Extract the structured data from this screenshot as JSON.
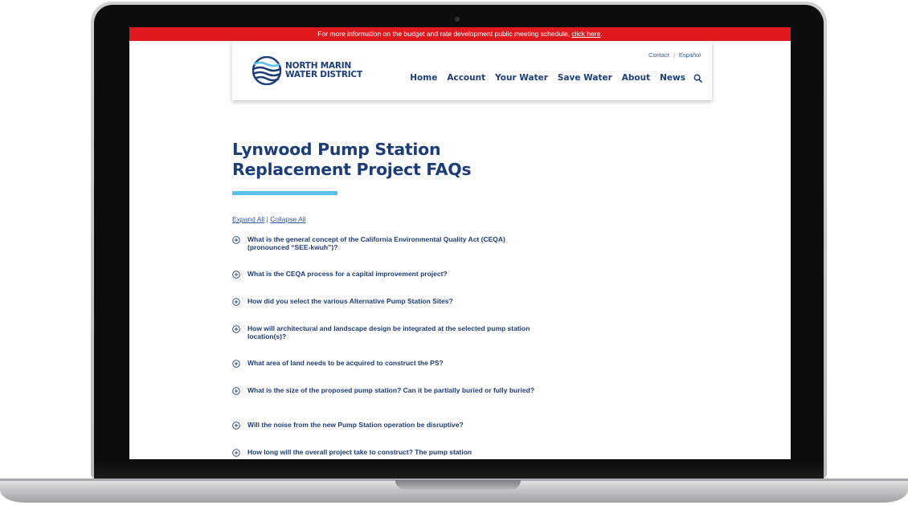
{
  "alert": {
    "text": "For more information on the budget and rate development public meeting schedule, ",
    "link": "click here",
    "suffix": "."
  },
  "brand": {
    "line1": "NORTH MARIN",
    "line2": "WATER DISTRICT",
    "color": "#1d3d78",
    "logo_icon": "water-waves-logo-icon"
  },
  "utility": {
    "contact": "Contact",
    "sep": "|",
    "espanol": "Español"
  },
  "nav": {
    "items": [
      "Home",
      "Account",
      "Your Water",
      "Save Water",
      "About",
      "News"
    ],
    "search_icon": "search-icon"
  },
  "page": {
    "title_line1": "Lynwood Pump Station",
    "title_line2": "Replacement Project FAQs",
    "accent": "#5bc0eb",
    "expand_all": "Expand All",
    "sep": " | ",
    "collapse_all": "Collapse All"
  },
  "faqs": [
    "What is the general concept of the California Environmental Quality Act (CEQA) (pronounced “SEE-kwuh”)?",
    "What is the CEQA process for a capital improvement project?",
    "How did you select the various Alternative Pump Station Sites?",
    "How will architectural and landscape design be integrated at the selected pump station location(s)?",
    "What area of land needs to be acquired to construct the PS?",
    "What is the size of the proposed pump station? Can it be partially buried or fully buried?",
    "Will the noise from the new Pump Station operation be disruptive?",
    "How long will the overall project take to construct? The pump station"
  ],
  "colors": {
    "alert_red": "#e0191f",
    "navy": "#1d3d78",
    "link_blue": "#2e5a9c"
  }
}
